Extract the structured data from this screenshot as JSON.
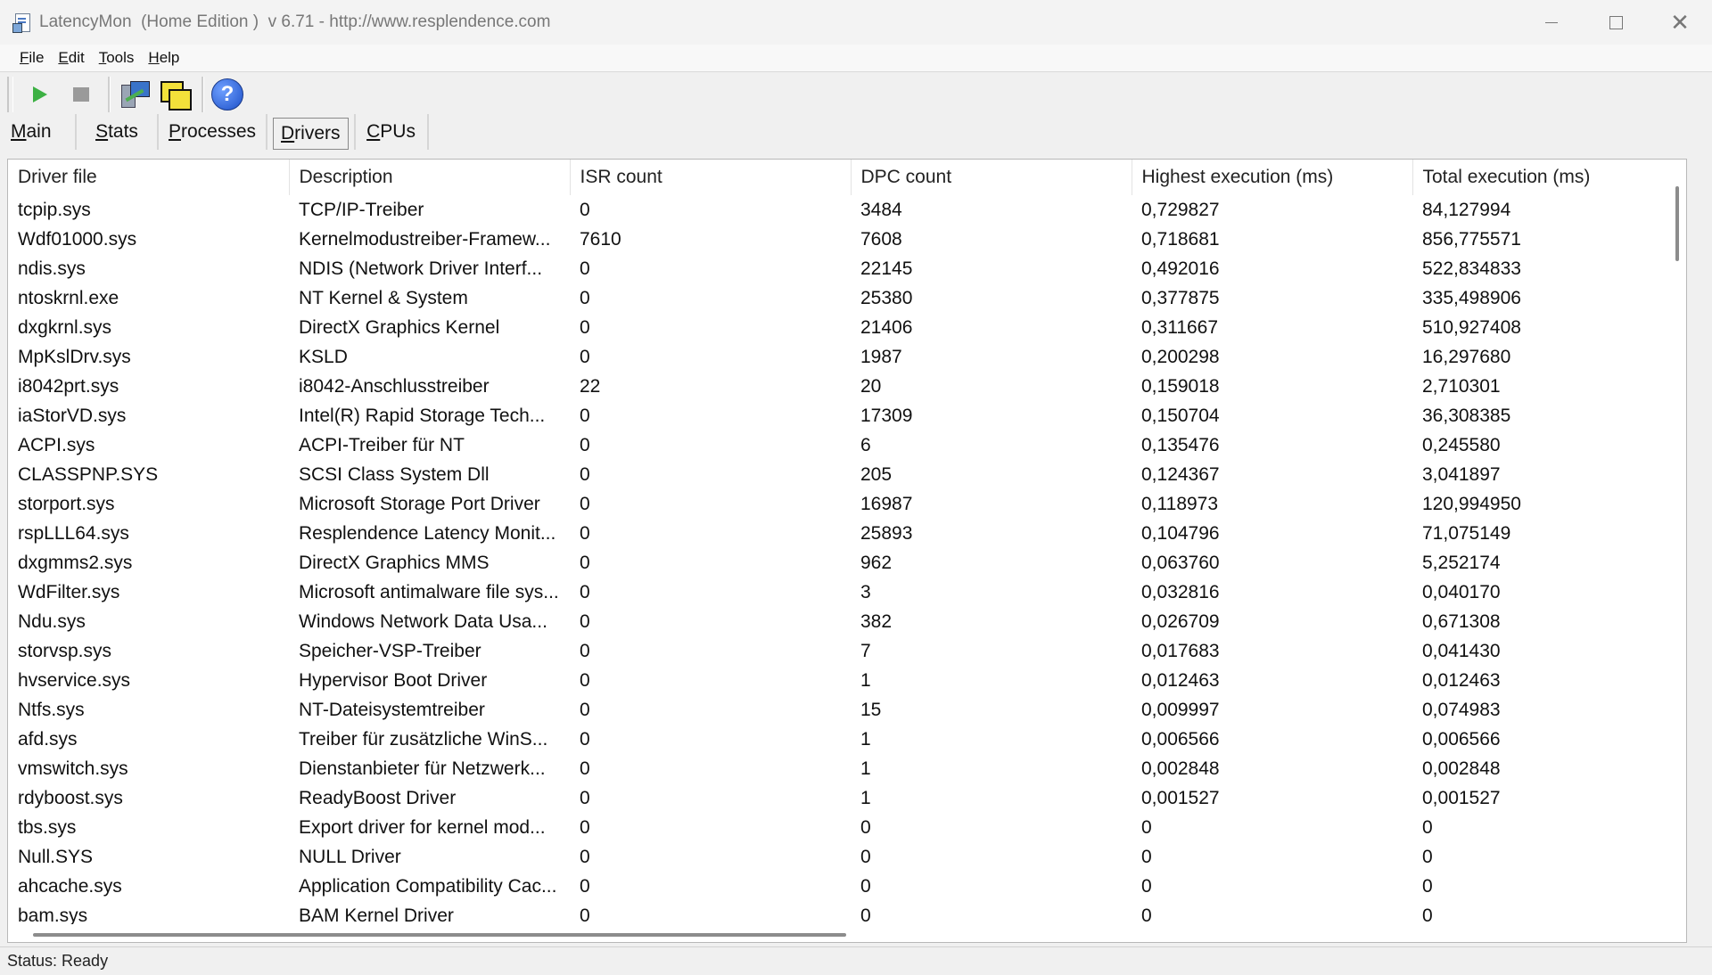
{
  "window": {
    "title": "LatencyMon  (Home Edition )  v 6.71 - http://www.resplendence.com",
    "min_glyph": "",
    "close_glyph": "✕"
  },
  "menu": [
    {
      "label": "File",
      "accel": "F",
      "rest": "ile"
    },
    {
      "label": "Edit",
      "accel": "E",
      "rest": "dit"
    },
    {
      "label": "Tools",
      "accel": "T",
      "rest": "ools"
    },
    {
      "label": "Help",
      "accel": "H",
      "rest": "elp"
    }
  ],
  "toolbar": {
    "icons": [
      "play-icon",
      "stop-icon",
      "cpu-monitor-icon",
      "windows-icon",
      "help-icon"
    ],
    "help_glyph": "?"
  },
  "tabs": {
    "main": {
      "accel": "M",
      "rest": "ain"
    },
    "stats": {
      "accel": "S",
      "rest": "tats"
    },
    "processes": {
      "accel": "P",
      "rest": "rocesses"
    },
    "drivers": {
      "accel": "D",
      "rest": "rivers"
    },
    "cpus": {
      "accel": "C",
      "rest": "PUs"
    },
    "active": "Drivers"
  },
  "table": {
    "columns": [
      "Driver file",
      "Description",
      "ISR count",
      "DPC count",
      "Highest execution (ms)",
      "Total execution (ms)"
    ],
    "rows": [
      [
        "tcpip.sys",
        "TCP/IP-Treiber",
        "0",
        "3484",
        "0,729827",
        "84,127994"
      ],
      [
        "Wdf01000.sys",
        "Kernelmodustreiber-Framew...",
        "7610",
        "7608",
        "0,718681",
        "856,775571"
      ],
      [
        "ndis.sys",
        "NDIS (Network Driver Interf...",
        "0",
        "22145",
        "0,492016",
        "522,834833"
      ],
      [
        "ntoskrnl.exe",
        "NT Kernel & System",
        "0",
        "25380",
        "0,377875",
        "335,498906"
      ],
      [
        "dxgkrnl.sys",
        "DirectX Graphics Kernel",
        "0",
        "21406",
        "0,311667",
        "510,927408"
      ],
      [
        "MpKslDrv.sys",
        "KSLD",
        "0",
        "1987",
        "0,200298",
        "16,297680"
      ],
      [
        "i8042prt.sys",
        "i8042-Anschlusstreiber",
        "22",
        "20",
        "0,159018",
        "2,710301"
      ],
      [
        "iaStorVD.sys",
        "Intel(R) Rapid Storage Tech...",
        "0",
        "17309",
        "0,150704",
        "36,308385"
      ],
      [
        "ACPI.sys",
        "ACPI-Treiber für NT",
        "0",
        "6",
        "0,135476",
        "0,245580"
      ],
      [
        "CLASSPNP.SYS",
        "SCSI Class System Dll",
        "0",
        "205",
        "0,124367",
        "3,041897"
      ],
      [
        "storport.sys",
        "Microsoft Storage Port Driver",
        "0",
        "16987",
        "0,118973",
        "120,994950"
      ],
      [
        "rspLLL64.sys",
        "Resplendence Latency Monit...",
        "0",
        "25893",
        "0,104796",
        "71,075149"
      ],
      [
        "dxgmms2.sys",
        "DirectX Graphics MMS",
        "0",
        "962",
        "0,063760",
        "5,252174"
      ],
      [
        "WdFilter.sys",
        "Microsoft antimalware file sys...",
        "0",
        "3",
        "0,032816",
        "0,040170"
      ],
      [
        "Ndu.sys",
        "Windows Network Data Usa...",
        "0",
        "382",
        "0,026709",
        "0,671308"
      ],
      [
        "storvsp.sys",
        "Speicher-VSP-Treiber",
        "0",
        "7",
        "0,017683",
        "0,041430"
      ],
      [
        "hvservice.sys",
        "Hypervisor Boot Driver",
        "0",
        "1",
        "0,012463",
        "0,012463"
      ],
      [
        "Ntfs.sys",
        "NT-Dateisystemtreiber",
        "0",
        "15",
        "0,009997",
        "0,074983"
      ],
      [
        "afd.sys",
        "Treiber für zusätzliche WinS...",
        "0",
        "1",
        "0,006566",
        "0,006566"
      ],
      [
        "vmswitch.sys",
        "Dienstanbieter für Netzwerk...",
        "0",
        "1",
        "0,002848",
        "0,002848"
      ],
      [
        "rdyboost.sys",
        "ReadyBoost Driver",
        "0",
        "1",
        "0,001527",
        "0,001527"
      ],
      [
        "tbs.sys",
        "Export driver for kernel mod...",
        "0",
        "0",
        "0",
        "0"
      ],
      [
        "Null.SYS",
        "NULL Driver",
        "0",
        "0",
        "0",
        "0"
      ],
      [
        "ahcache.sys",
        "Application Compatibility Cac...",
        "0",
        "0",
        "0",
        "0"
      ],
      [
        "bam.sys",
        "BAM Kernel Driver",
        "0",
        "0",
        "0",
        "0"
      ]
    ]
  },
  "status": {
    "text": "Status: Ready"
  }
}
